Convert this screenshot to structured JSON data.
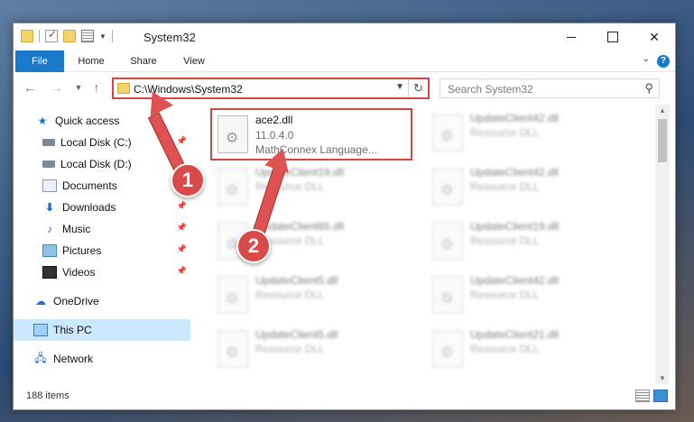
{
  "window": {
    "title": "System32",
    "controls": {
      "minimize": "",
      "maximize": "",
      "close": "✕"
    }
  },
  "ribbon": {
    "tabs": [
      "File",
      "Home",
      "Share",
      "View"
    ],
    "help": "?"
  },
  "address_bar": {
    "path": "C:\\Windows\\System32",
    "search_placeholder": "Search System32"
  },
  "sidebar": {
    "items": [
      {
        "label": "Quick access",
        "icon": "star-icon",
        "pinned": false
      },
      {
        "label": "Local Disk (C:)",
        "icon": "disk-icon",
        "pinned": true
      },
      {
        "label": "Local Disk (D:)",
        "icon": "disk-icon",
        "pinned": false
      },
      {
        "label": "Documents",
        "icon": "documents-icon",
        "pinned": true
      },
      {
        "label": "Downloads",
        "icon": "download-icon",
        "pinned": true
      },
      {
        "label": "Music",
        "icon": "music-icon",
        "pinned": true
      },
      {
        "label": "Pictures",
        "icon": "pictures-icon",
        "pinned": true
      },
      {
        "label": "Videos",
        "icon": "videos-icon",
        "pinned": true
      },
      {
        "label": "OneDrive",
        "icon": "onedrive-icon",
        "pinned": false
      },
      {
        "label": "This PC",
        "icon": "pc-icon",
        "pinned": false,
        "selected": true
      },
      {
        "label": "Network",
        "icon": "network-icon",
        "pinned": false
      }
    ]
  },
  "files": {
    "highlighted": {
      "name": "ace2.dll",
      "version": "11.0.4.0",
      "description": "MathConnex Language..."
    },
    "col1": [
      {
        "name": "UpdateClient19.dll",
        "type": "Resource DLL"
      },
      {
        "name": "UpdateClient65.dll",
        "type": "Resource DLL"
      },
      {
        "name": "UpdateClient5.dll",
        "type": "Resource DLL"
      },
      {
        "name": "UpdateClient5.dll",
        "type": "Resource DLL"
      }
    ],
    "col2": [
      {
        "name": "UpdateClient42.dll",
        "type": "Resource DLL"
      },
      {
        "name": "UpdateClient42.dll",
        "type": "Resource DLL"
      },
      {
        "name": "UpdateClient19.dll",
        "type": "Resource DLL"
      },
      {
        "name": "UpdateClient42.dll",
        "type": "Resource DLL"
      },
      {
        "name": "UpdateClient21.dll",
        "type": "Resource DLL"
      }
    ]
  },
  "status": {
    "item_count": "188 items"
  },
  "annotations": {
    "step1": "1",
    "step2": "2"
  },
  "colors": {
    "accent": "#1979ca",
    "highlight": "#d64444",
    "annotation": "#e05252"
  }
}
